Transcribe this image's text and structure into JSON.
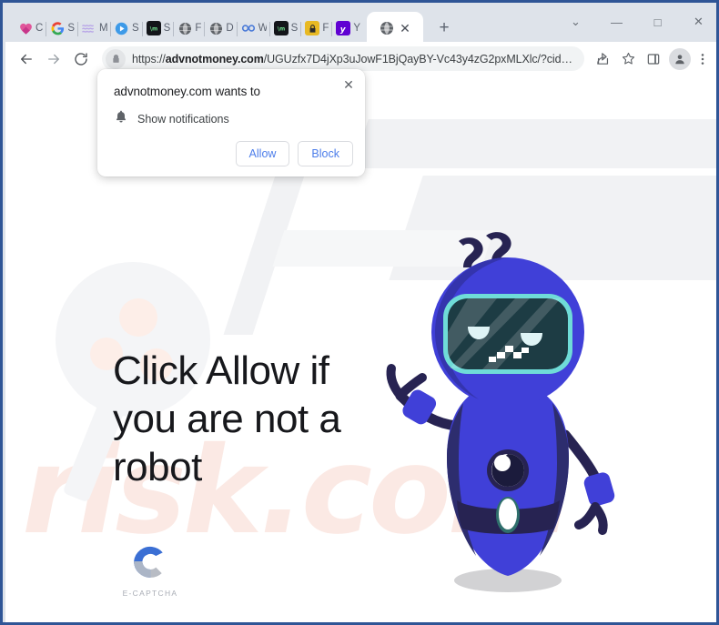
{
  "window": {
    "controls": [
      {
        "name": "tab-search",
        "glyph": "⌄"
      },
      {
        "name": "minimize",
        "glyph": "—"
      },
      {
        "name": "maximize",
        "glyph": "□"
      },
      {
        "name": "close",
        "glyph": "✕"
      }
    ]
  },
  "tabs": {
    "background_tabs": [
      {
        "title": "C",
        "favicon": "heart-pink-icon",
        "color": "#e0559a"
      },
      {
        "title": "S",
        "favicon": "google-g-icon",
        "color": "#4285f4"
      },
      {
        "title": "M",
        "favicon": "waves-purple-icon",
        "color": "#b9a7e8"
      },
      {
        "title": "S",
        "favicon": "play-circle-blue-icon",
        "color": "#3d9ae8"
      },
      {
        "title": "S",
        "favicon": "dark-square-green-icon",
        "color": "#1c1c1c"
      },
      {
        "title": "F",
        "favicon": "globe-gray-icon",
        "color": "#5f6368"
      },
      {
        "title": "D",
        "favicon": "globe-gray-icon",
        "color": "#5f6368"
      },
      {
        "title": "W",
        "favicon": "infinity-blue-icon",
        "color": "#4b7bd8"
      },
      {
        "title": "S",
        "favicon": "dark-square-green-icon",
        "color": "#1c1c1c"
      },
      {
        "title": "F",
        "favicon": "lock-yellow-icon",
        "color": "#e8b923"
      },
      {
        "title": "Y",
        "favicon": "yahoo-purple-icon",
        "color": "#6001d2"
      }
    ],
    "active_tab": {
      "favicon": "globe-gray-icon",
      "close_glyph": "✕"
    },
    "new_tab_glyph": "+"
  },
  "toolbar": {
    "back_label": "←",
    "forward_label": "→",
    "reload_label": "C",
    "url": "https://advnotmoney.com/UGUzfx7D4jXp3uJowF1BjQayBY-Vc43y4zG2pxMLXlc/?cid…",
    "url_prefix": "https://",
    "url_domain": "advnotmoney.com",
    "url_rest": "/UGUzfx7D4jXp3uJowF1BjQayBY-Vc43y4zG2pxMLXlc/?cid…",
    "lock_icon": "lock-icon",
    "share_icon": "share-icon",
    "bookmark_icon": "star-icon",
    "sidepanel_icon": "side-panel-icon",
    "profile_icon": "profile-avatar-icon",
    "menu_icon": "three-dot-menu-icon"
  },
  "permission_dialog": {
    "title": "advnotmoney.com wants to",
    "permission_label": "Show notifications",
    "permission_icon": "bell-icon",
    "close_glyph": "✕",
    "allow_label": "Allow",
    "block_label": "Block",
    "accent_color": "#4c7dea"
  },
  "page": {
    "headline": "Click Allow if you are not a robot",
    "captcha_label": "E-CAPTCHA",
    "captcha_logo": "letter-c-logo",
    "watermark_primary": "risk.com",
    "watermark_secondary": "PC",
    "robot_illustration": "confused-robot-mascot",
    "robot_question_marks": "??",
    "colors": {
      "robot_body": "#4040d8",
      "robot_body_dark": "#2d2d6e",
      "robot_visor": "#1d3c44",
      "robot_visor_edge": "#6fdcd8",
      "captcha_blue": "#3b6fd4",
      "captcha_gray": "#b8bcc4",
      "watermark_pink": "#fbe9e4",
      "watermark_gray": "#f1f2f4"
    }
  }
}
